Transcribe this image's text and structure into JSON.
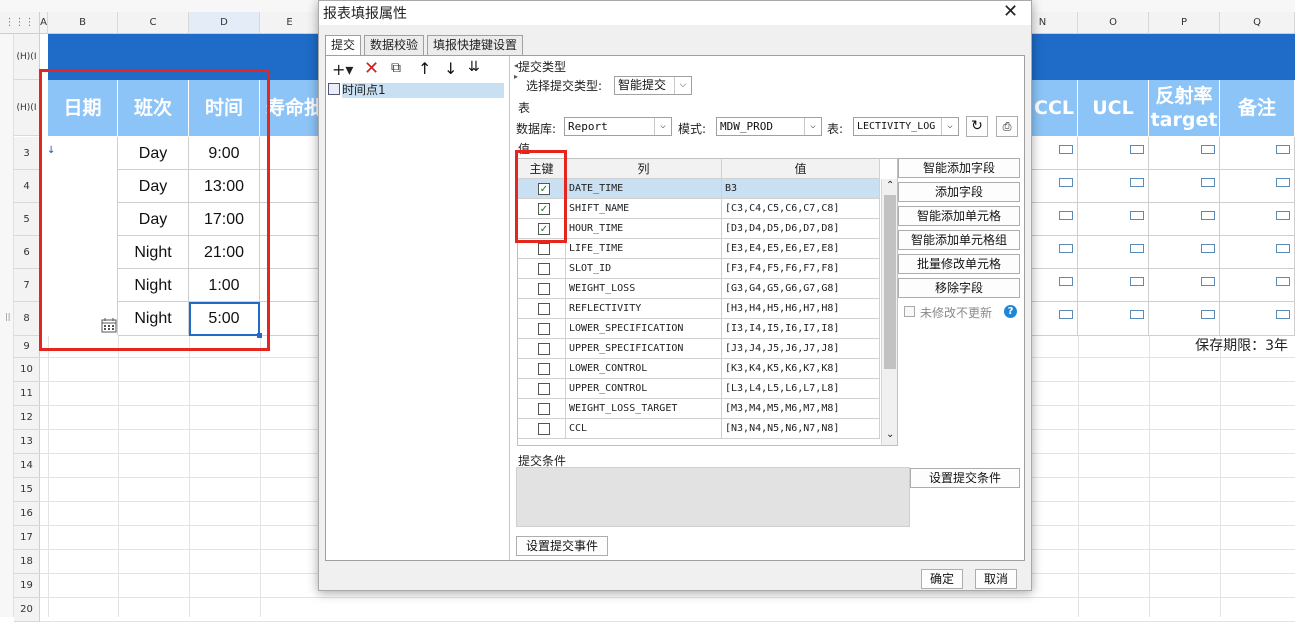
{
  "spreadsheet": {
    "columns": [
      "A",
      "B",
      "C",
      "D",
      "E",
      "N",
      "O",
      "P",
      "Q"
    ],
    "row_labels_top": [
      "(H)(I",
      "(H)(I"
    ],
    "rows": [
      "3",
      "4",
      "5",
      "6",
      "7",
      "8",
      "9",
      "10",
      "11",
      "12",
      "13",
      "14",
      "15",
      "16",
      "17",
      "18",
      "19",
      "20"
    ],
    "headers_left": [
      "日期",
      "班次",
      "时间",
      "寿命批"
    ],
    "headers_right": [
      "CCL",
      "UCL",
      "反射率target",
      "备注"
    ],
    "shifts": [
      "Day",
      "Day",
      "Day",
      "Night",
      "Night",
      "Night"
    ],
    "times": [
      "9:00",
      "13:00",
      "17:00",
      "21:00",
      "1:00",
      "5:00"
    ],
    "retention": "保存期限：3年"
  },
  "dialog": {
    "title": "报表填报属性",
    "tabs": [
      "提交",
      "数据校验",
      "填报快捷键设置"
    ],
    "tree_item": "时间点1",
    "submit_type_group": "提交类型",
    "submit_type_label": "选择提交类型:",
    "submit_type_value": "智能提交",
    "table_group": "表",
    "db_label": "数据库:",
    "db_value": "Report",
    "schema_label": "模式:",
    "schema_value": "MDW_PROD",
    "table_label": "表:",
    "table_value": "LECTIVITY_LOG",
    "value_group": "值",
    "grid_headers": [
      "主键",
      "列",
      "值"
    ],
    "grid_rows": [
      {
        "key": true,
        "col": "DATE_TIME",
        "val": "B3"
      },
      {
        "key": true,
        "col": "SHIFT_NAME",
        "val": "[C3,C4,C5,C6,C7,C8]"
      },
      {
        "key": true,
        "col": "HOUR_TIME",
        "val": "[D3,D4,D5,D6,D7,D8]"
      },
      {
        "key": false,
        "col": "LIFE_TIME",
        "val": "[E3,E4,E5,E6,E7,E8]"
      },
      {
        "key": false,
        "col": "SLOT_ID",
        "val": "[F3,F4,F5,F6,F7,F8]"
      },
      {
        "key": false,
        "col": "WEIGHT_LOSS",
        "val": "[G3,G4,G5,G6,G7,G8]"
      },
      {
        "key": false,
        "col": "REFLECTIVITY",
        "val": "[H3,H4,H5,H6,H7,H8]"
      },
      {
        "key": false,
        "col": "LOWER_SPECIFICATION",
        "val": "[I3,I4,I5,I6,I7,I8]"
      },
      {
        "key": false,
        "col": "UPPER_SPECIFICATION",
        "val": "[J3,J4,J5,J6,J7,J8]"
      },
      {
        "key": false,
        "col": "LOWER_CONTROL",
        "val": "[K3,K4,K5,K6,K7,K8]"
      },
      {
        "key": false,
        "col": "UPPER_CONTROL",
        "val": "[L3,L4,L5,L6,L7,L8]"
      },
      {
        "key": false,
        "col": "WEIGHT_LOSS_TARGET",
        "val": "[M3,M4,M5,M6,M7,M8]"
      },
      {
        "key": false,
        "col": "CCL",
        "val": "[N3,N4,N5,N6,N7,N8]"
      }
    ],
    "side_buttons": [
      "智能添加字段",
      "添加字段",
      "智能添加单元格",
      "智能添加单元格组",
      "批量修改单元格",
      "移除字段"
    ],
    "no_update_label": "未修改不更新",
    "condition_group": "提交条件",
    "set_condition": "设置提交条件",
    "set_event": "设置提交事件",
    "ok": "确定",
    "cancel": "取消"
  },
  "colors": {
    "header_blue": "#8cc4f7",
    "banner_blue": "#1e6cc8",
    "highlight_red": "#e5261f",
    "selected_row": "#c9dff2"
  }
}
